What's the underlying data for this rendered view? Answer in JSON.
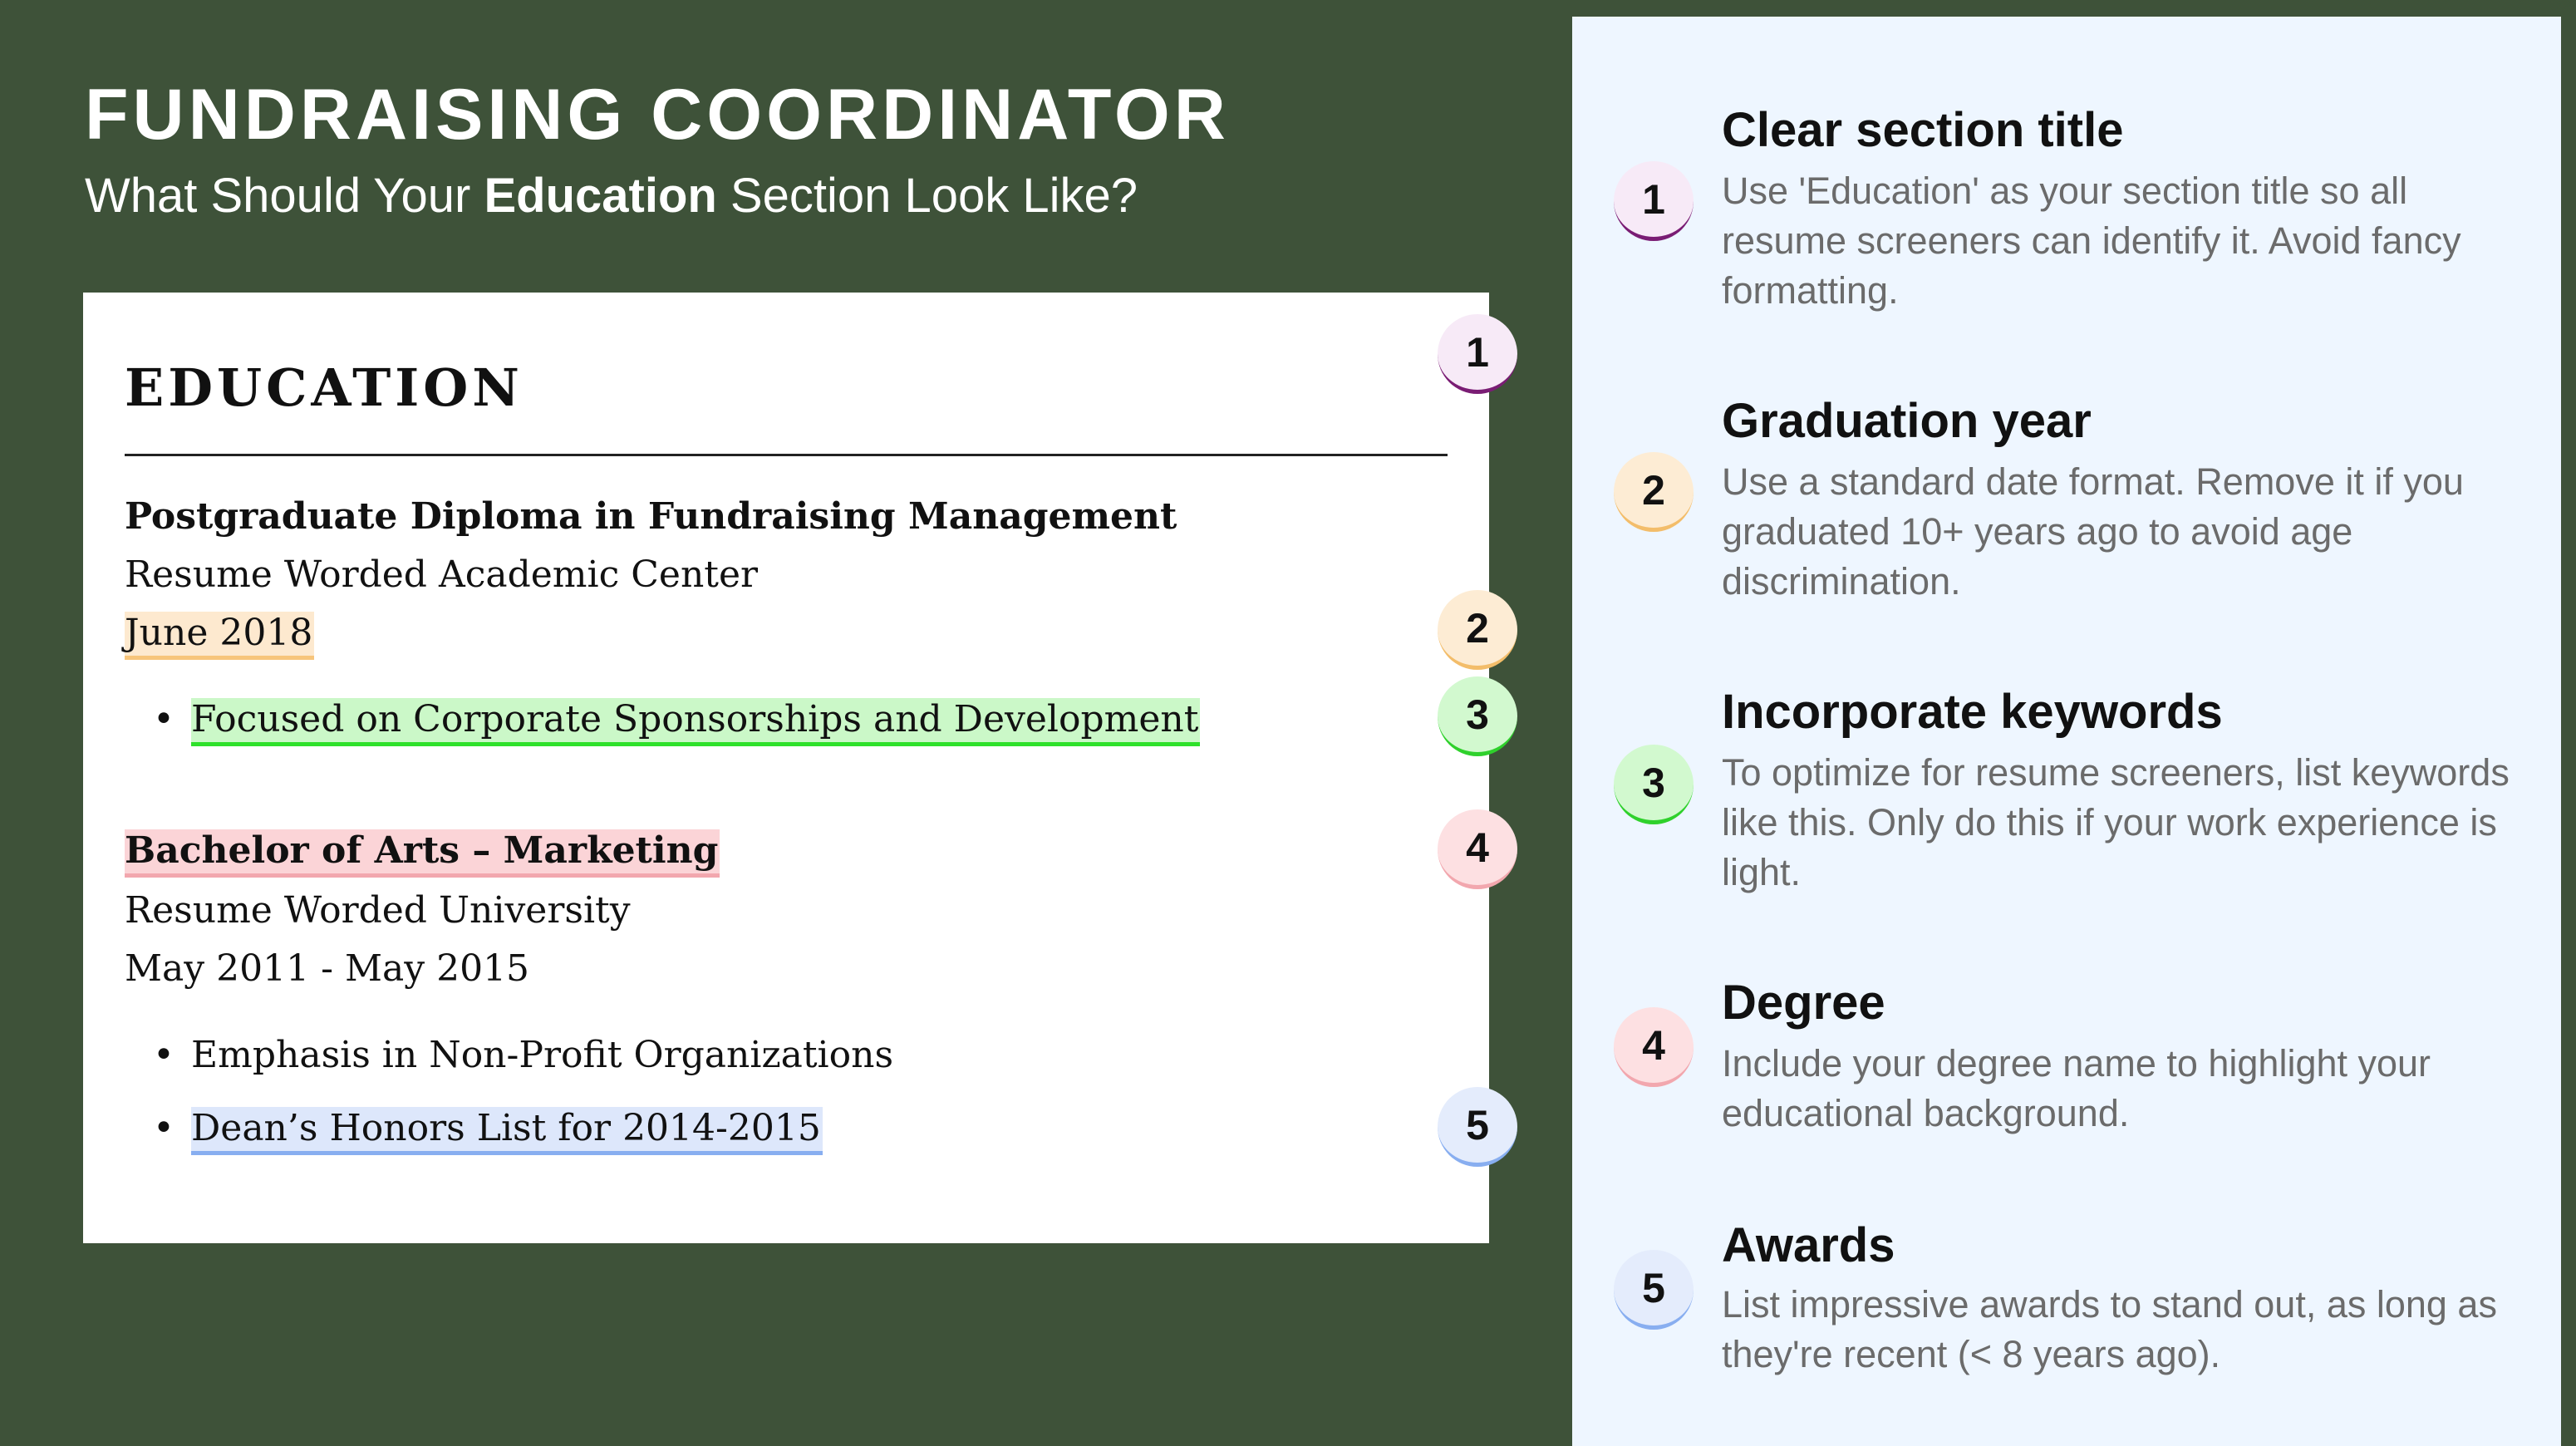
{
  "header": {
    "title": "FUNDRAISING COORDINATOR",
    "subtitle_before": "What Should Your ",
    "subtitle_bold": "Education",
    "subtitle_after": " Section Look Like?"
  },
  "resume": {
    "section_title": "EDUCATION",
    "entries": [
      {
        "degree": "Postgraduate Diploma in Fundraising Management",
        "school": "Resume Worded Academic Center",
        "date": "June 2018",
        "bullets": [
          "Focused on Corporate Sponsorships and Development"
        ]
      },
      {
        "degree": "Bachelor of Arts – Marketing",
        "school": "Resume Worded University",
        "date": "May 2011 - May 2015",
        "bullets": [
          "Emphasis in Non-Profit Organizations",
          "Dean’s Honors List for 2014-2015"
        ]
      }
    ],
    "bullet_char": "•"
  },
  "badges": [
    "1",
    "2",
    "3",
    "4",
    "5"
  ],
  "tips": [
    {
      "number": "1",
      "title": "Clear section title",
      "text": "Use 'Education' as your section title so all resume screeners can identify it. Avoid fancy formatting."
    },
    {
      "number": "2",
      "title": "Graduation year",
      "text": "Use a standard date format. Remove it if you graduated 10+ years ago to avoid age discrimination."
    },
    {
      "number": "3",
      "title": "Incorporate keywords",
      "text": "To optimize for resume screeners, list keywords like this. Only do this if your work experience is light."
    },
    {
      "number": "4",
      "title": "Degree",
      "text": "Include your degree name to highlight your educational background."
    },
    {
      "number": "5",
      "title": "Awards",
      "text": "List impressive awards to stand out, as long as they're recent (< 8 years ago)."
    }
  ],
  "colors": {
    "background": "#3e5239",
    "panel": "#eef6ff",
    "badge_1": "#7a1d74",
    "badge_2": "#f3bd6a",
    "badge_3": "#2fd12c",
    "badge_4": "#f2a7ae",
    "badge_5": "#88aef0"
  }
}
